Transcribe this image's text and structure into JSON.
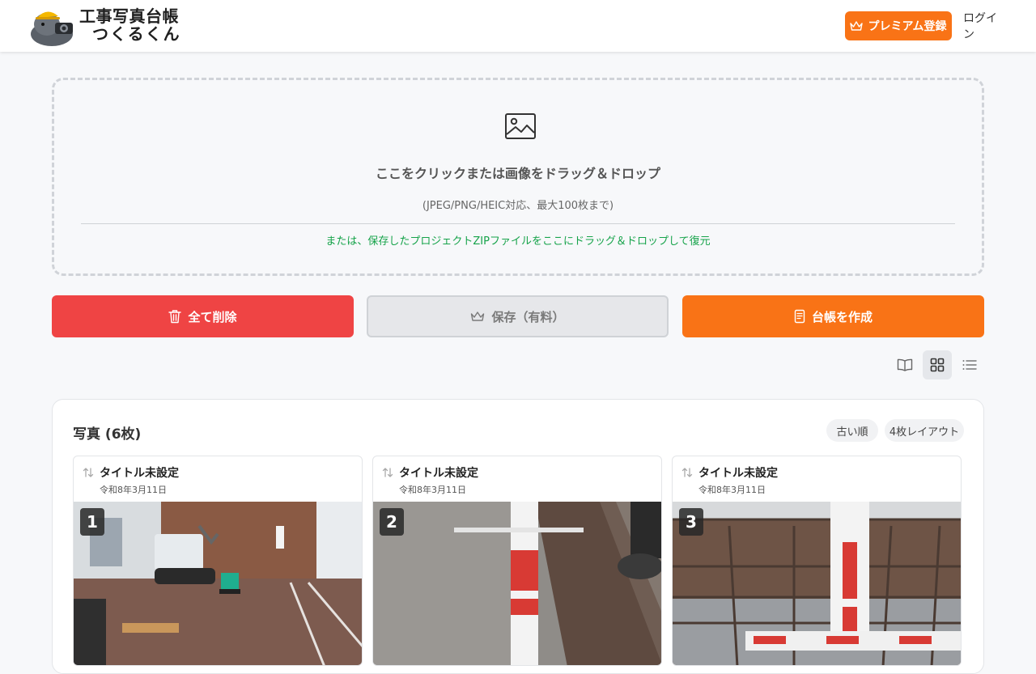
{
  "header": {
    "logo_line1": "工事写真台帳",
    "logo_line2": "つくるくん",
    "premium_label": "プレミアム登録",
    "login_label": "ログイン"
  },
  "dropzone": {
    "main_text": "ここをクリックまたは画像をドラッグ＆ドロップ",
    "sub_text": "(JPEG/PNG/HEIC対応、最大100枚まで)",
    "zip_text": "または、保存したプロジェクトZIPファイルをここにドラッグ＆ドロップして復元"
  },
  "actions": {
    "delete_label": "全て削除",
    "save_label": "保存（有料）",
    "create_label": "台帳を作成"
  },
  "view_modes": [
    "book-icon",
    "grid-icon",
    "list-icon"
  ],
  "active_view": "grid",
  "photos_panel": {
    "title": "写真 (6枚)",
    "sort_label": "古い順",
    "layout_label": "4枚レイアウト",
    "cards": [
      {
        "number": "1",
        "title": "タイトル未設定",
        "date": "令和8年3月11日"
      },
      {
        "number": "2",
        "title": "タイトル未設定",
        "date": "令和8年3月11日"
      },
      {
        "number": "3",
        "title": "タイトル未設定",
        "date": "令和8年3月11日"
      }
    ]
  },
  "colors": {
    "accent_orange": "#f97316",
    "danger_red": "#ef4444",
    "success_green": "#16a34a"
  }
}
